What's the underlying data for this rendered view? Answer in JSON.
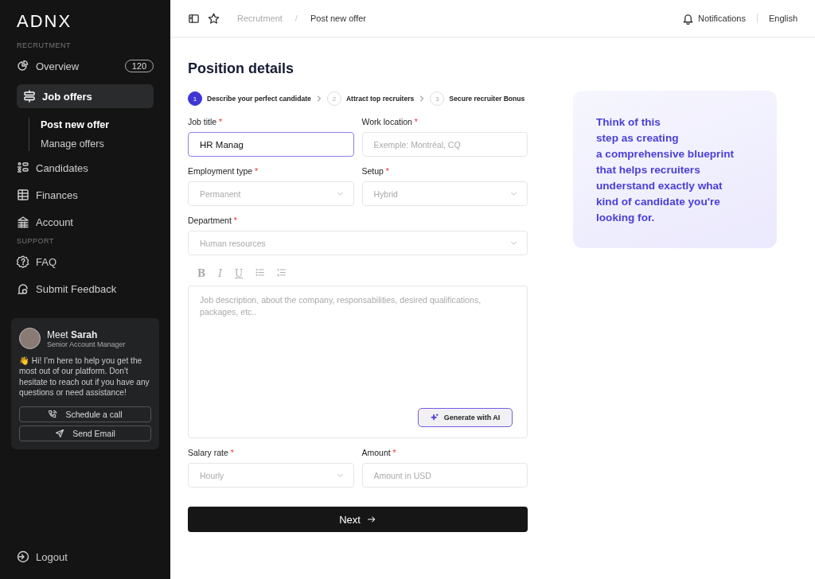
{
  "sidebar": {
    "logo": "ADNX",
    "sections": [
      {
        "title": "RECRUTMENT",
        "items": [
          {
            "label": "Overview",
            "kind": "chart",
            "badge": "120",
            "selected": false
          },
          {
            "label": "Job offers",
            "kind": "signpost",
            "selected": true,
            "children": [
              {
                "label": "Post new offer",
                "selected": true
              },
              {
                "label": "Manage offers",
                "selected": false
              }
            ]
          },
          {
            "label": "Candidates",
            "kind": "people",
            "selected": false
          },
          {
            "label": "Finances",
            "kind": "ledger",
            "selected": false
          },
          {
            "label": "Account",
            "kind": "bank",
            "selected": false
          }
        ]
      },
      {
        "title": "SUPPORT",
        "items": [
          {
            "label": "FAQ",
            "kind": "help",
            "selected": false
          },
          {
            "label": "Submit Feedback",
            "kind": "feedback",
            "selected": false
          }
        ]
      }
    ],
    "contact": {
      "name": "Meet **Sarah**",
      "role": "Senior Account Manager",
      "message": "👋 Hi! I'm here to help you get the most out of our platform. Don't hesitate to reach out if you have any questions or need assistance!",
      "buttons": [
        {
          "label": "Schedule a call",
          "kind": "phone"
        },
        {
          "label": "Send Email",
          "kind": "send"
        }
      ]
    },
    "logout": "Logout"
  },
  "topbar": {
    "breadcrumbs": [
      "Recrutment",
      "Post new offer"
    ],
    "separator": "/",
    "notifications": "Notifications",
    "language": "English"
  },
  "form": {
    "title": "Position details",
    "steps": [
      {
        "number": "1",
        "label": "Describe your perfect candidate",
        "selected": true
      },
      {
        "number": "2",
        "label": "Attract top recruiters",
        "selected": false
      },
      {
        "number": "3",
        "label": "Secure recruiter Bonus",
        "selected": false
      }
    ],
    "rows": [
      [
        {
          "kind": "text",
          "label": "Job title",
          "required_mark": "*",
          "value": "HR Manag",
          "focused": true
        },
        {
          "kind": "text",
          "label": "Work location",
          "required_mark": "*",
          "placeholder": "Exemple: Montréal, CQ",
          "focused": false
        }
      ],
      [
        {
          "kind": "select",
          "label": "Employment type",
          "required_mark": "*",
          "placeholder": "Permanent"
        },
        {
          "kind": "select",
          "label": "Setup",
          "required_mark": "*",
          "placeholder": "Hybrid"
        }
      ],
      [
        {
          "kind": "select",
          "label": "Department",
          "required_mark": "*",
          "placeholder": "Human resources"
        }
      ],
      [
        {
          "kind": "editor",
          "tools": [
            {
              "kind": "char",
              "text": "B"
            },
            {
              "kind": "char",
              "text": "I"
            },
            {
              "kind": "char",
              "text": "U"
            },
            {
              "kind": "bullets"
            },
            {
              "kind": "numbers"
            }
          ],
          "placeholder": "Job description, about the company, responsabilities, desired qualifications, packages, etc..",
          "ai_button": "Generate with AI"
        }
      ],
      [
        {
          "kind": "select",
          "label": "Salary rate",
          "required_mark": "*",
          "placeholder": "Hourly"
        },
        {
          "kind": "text",
          "label": "Amount",
          "required_mark": "*",
          "placeholder": "Amount in USD",
          "focused": false
        }
      ]
    ],
    "next": "Next"
  },
  "tip": {
    "lines": [
      "Think of this",
      "step as creating",
      "a comprehensive blueprint",
      "that helps recruiters",
      "understand exactly what",
      "kind of candidate you're",
      "looking for."
    ]
  }
}
